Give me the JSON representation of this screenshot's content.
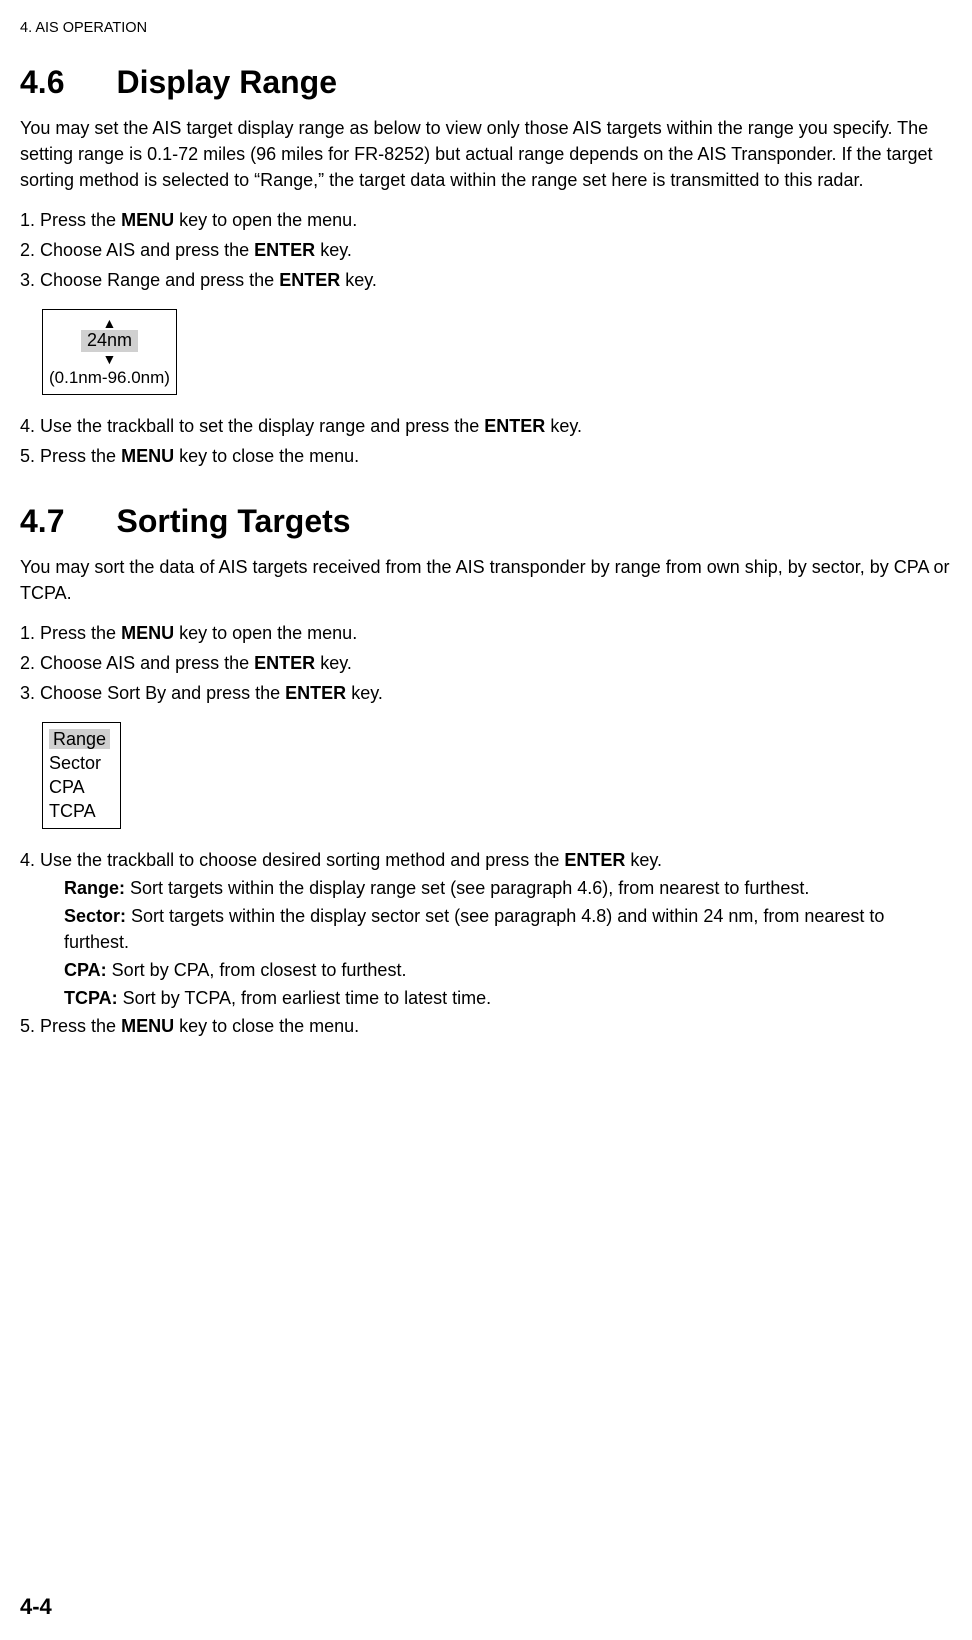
{
  "page": {
    "header": "4. AIS OPERATION",
    "footer": "4-4"
  },
  "section46": {
    "number": "4.6",
    "title": "Display Range",
    "intro": "You may set the AIS target display range as below to view only those AIS targets within the range you specify. The setting range is 0.1-72 miles (96 miles for FR-8252) but actual range depends on the AIS Transponder. If the target sorting method is selected to “Range,” the target data within the range set here is transmitted to this radar.",
    "steps_first": [
      {
        "num": "1.",
        "pre": "Press the ",
        "bold": "MENU",
        "post": " key to open the menu."
      },
      {
        "num": "2.",
        "pre": "Choose AIS and press the ",
        "bold": "ENTER",
        "post": " key."
      },
      {
        "num": "3.",
        "pre": "Choose Range and press the ",
        "bold": "ENTER",
        "post": " key."
      }
    ],
    "diagram": {
      "up": "▲",
      "value": "24nm",
      "down": "▼",
      "range": "(0.1nm-96.0nm)"
    },
    "steps_last": [
      {
        "num": "4.",
        "pre": "Use the trackball to set the display range and press the ",
        "bold": "ENTER",
        "post": " key."
      },
      {
        "num": "5.",
        "pre": "Press the ",
        "bold": "MENU",
        "post": " key to close the menu."
      }
    ]
  },
  "section47": {
    "number": "4.7",
    "title": "Sorting Targets",
    "intro": "You may sort the data of AIS targets received from the AIS transponder by range from own ship, by sector, by CPA or TCPA.",
    "steps_first": [
      {
        "num": "1.",
        "pre": "Press the ",
        "bold": "MENU",
        "post": " key to open the menu."
      },
      {
        "num": "2.",
        "pre": "Choose AIS and press the ",
        "bold": "ENTER",
        "post": " key."
      },
      {
        "num": "3.",
        "pre": "Choose Sort By and press the ",
        "bold": "ENTER",
        "post": " key."
      }
    ],
    "sortbox": {
      "opt1": "Range",
      "opt2": "Sector",
      "opt3": "CPA",
      "opt4": "TCPA"
    },
    "step4": {
      "num": "4.",
      "pre": "Use the trackball to choose desired sorting method and press the ",
      "bold": "ENTER",
      "post": " key."
    },
    "defs": {
      "range_label": "Range:",
      "range_text": " Sort targets within the display range set (see paragraph 4.6), from nearest to furthest.",
      "sector_label": "Sector:",
      "sector_text": " Sort targets within the display sector set (see paragraph 4.8) and within 24 nm, from nearest to furthest.",
      "cpa_label": "CPA:",
      "cpa_text": " Sort by CPA, from closest to furthest.",
      "tcpa_label": "TCPA:",
      "tcpa_text": " Sort by TCPA, from earliest time to latest time."
    },
    "step5": {
      "num": "5.",
      "pre": "Press the ",
      "bold": "MENU",
      "post": " key to close the menu."
    }
  }
}
